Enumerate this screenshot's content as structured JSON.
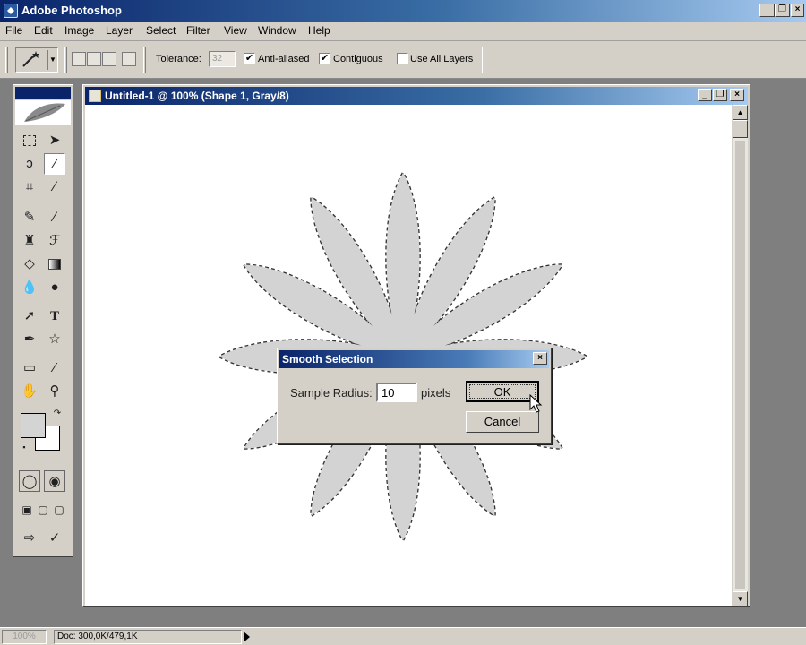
{
  "app": {
    "title": "Adobe Photoshop",
    "min": "_",
    "restore": "❐",
    "close": "×"
  },
  "menu": [
    "File",
    "Edit",
    "Image",
    "Layer",
    "Select",
    "Filter",
    "View",
    "Window",
    "Help"
  ],
  "options": {
    "tolerance_label": "Tolerance:",
    "tolerance_value": "32",
    "anti_aliased_label": "Anti-aliased",
    "anti_aliased_checked": "✔",
    "contiguous_label": "Contiguous",
    "contiguous_checked": "✔",
    "use_all_layers_label": "Use All Layers"
  },
  "document": {
    "title": "Untitled-1 @ 100% (Shape 1, Gray/8)",
    "min": "_",
    "restore": "❐",
    "close": "×",
    "scroll_up": "▲",
    "scroll_down": "▼"
  },
  "dialog": {
    "title": "Smooth Selection",
    "close": "×",
    "sample_radius_label": "Sample Radius:",
    "sample_radius_value": "10",
    "units": "pixels",
    "ok_label": "OK",
    "cancel_label": "Cancel"
  },
  "status": {
    "zoom": "100%",
    "doc": "Doc: 300,0K/479,1K"
  },
  "colors": {
    "shape_fill": "#d3d3d3",
    "selection_stroke": "#333333",
    "title_blue": "#0a246a"
  },
  "icons": [
    "marquee-icon",
    "move-icon",
    "lasso-icon",
    "magic-wand-icon",
    "crop-icon",
    "slice-icon",
    "healing-brush-icon",
    "brush-icon",
    "stamp-icon",
    "history-brush-icon",
    "eraser-icon",
    "gradient-icon",
    "blur-icon",
    "dodge-icon",
    "path-select-icon",
    "type-icon",
    "pen-icon",
    "custom-shape-icon",
    "notes-icon",
    "eyedropper-icon",
    "hand-icon",
    "zoom-icon"
  ]
}
